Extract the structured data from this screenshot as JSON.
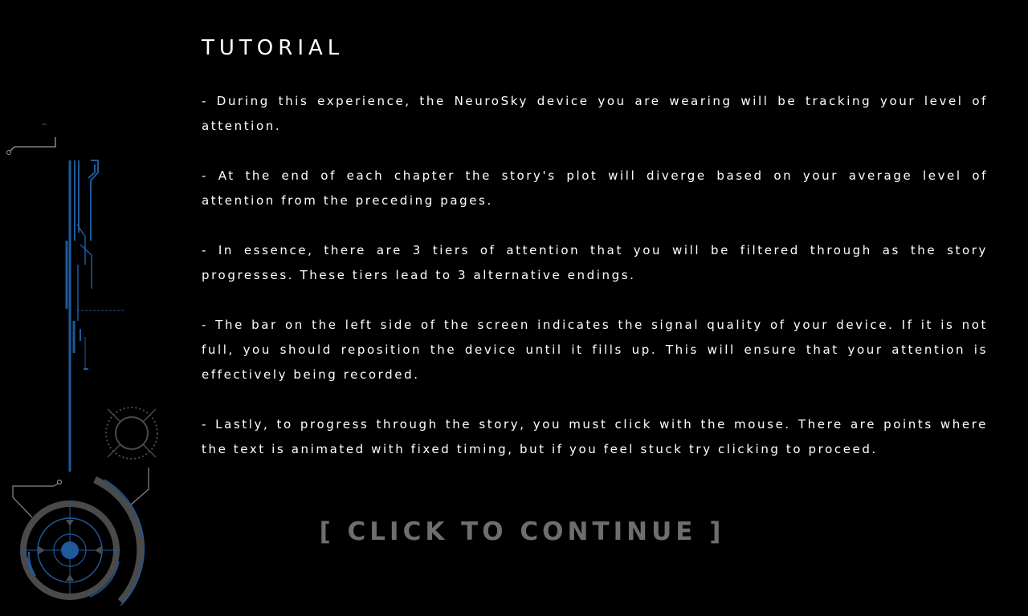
{
  "tutorial": {
    "title": "TUTORIAL",
    "paragraphs": [
      "- During this experience, the NeuroSky device you are wearing will be tracking your level of attention.",
      "- At the end of each chapter the story's plot will diverge based on your average level of attention from the preceding pages.",
      "- In essence, there are 3 tiers of attention that you will be filtered through as the story progresses. These tiers lead to 3 alternative endings.",
      "- The bar on the left side of the screen indicates the signal quality of your device. If it is not full, you should reposition the device until it fills up. This will ensure that your attention is effectively being recorded.",
      "- Lastly, to progress through the story, you must click with the mouse. There are points where the text is animated with fixed timing, but if you feel stuck try clicking to proceed."
    ],
    "continue_label": "[ CLICK TO CONTINUE ]"
  },
  "hud": {
    "signal_bar_icon": "signal-quality-bar",
    "crosshair_icon": "crosshair-dial",
    "radar_icon": "radar-gauge"
  },
  "colors": {
    "background": "#000000",
    "text": "#ffffff",
    "continue": "#6e6e6e",
    "hud_blue": "#1e5a9c",
    "hud_grey": "#4a4a4a"
  }
}
